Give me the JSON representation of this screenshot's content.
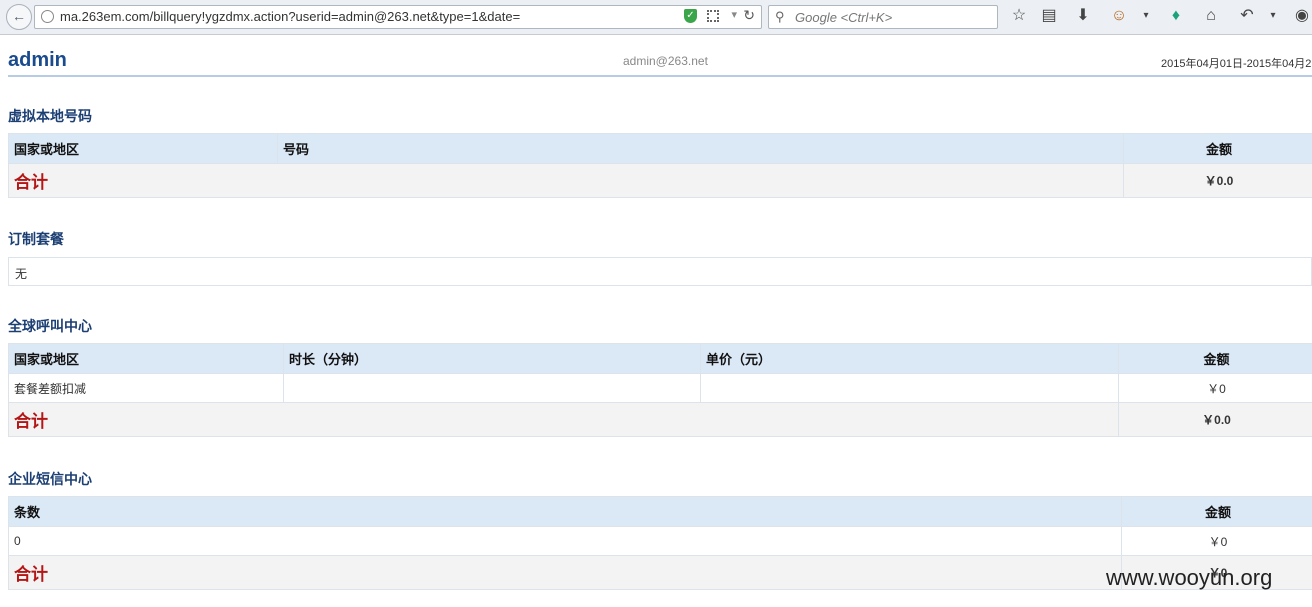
{
  "browser": {
    "url": "ma.263em.com/billquery!ygzdmx.action?userid=admin@263.net&type=1&date=",
    "search_placeholder": "Google <Ctrl+K>",
    "icons": [
      "back-icon",
      "star-icon",
      "clipboard-icon",
      "download-icon",
      "monkey-icon",
      "addon-icon",
      "home-icon",
      "undo-icon",
      "chat-icon"
    ]
  },
  "header": {
    "username": "admin",
    "email": "admin@263.net",
    "date_range": "2015年04月01日-2015年04月2"
  },
  "sections": {
    "virtual": {
      "title": "虚拟本地号码",
      "columns": [
        "国家或地区",
        "号码",
        "金额"
      ],
      "total_label": "合计",
      "total_amount": "￥0.0"
    },
    "package": {
      "title": "订制套餐",
      "value": "无"
    },
    "callcenter": {
      "title": "全球呼叫中心",
      "columns": [
        "国家或地区",
        "时长（分钟）",
        "单价（元）",
        "金额"
      ],
      "row": [
        "套餐差额扣减",
        "",
        "",
        "￥0"
      ],
      "total_label": "合计",
      "total_amount": "￥0.0"
    },
    "sms": {
      "title": "企业短信中心",
      "columns": [
        "条数",
        "金额"
      ],
      "row": [
        "0",
        "￥0"
      ],
      "total_label": "合计",
      "total_amount": "￥0"
    }
  },
  "watermark": "www.wooyun.org"
}
